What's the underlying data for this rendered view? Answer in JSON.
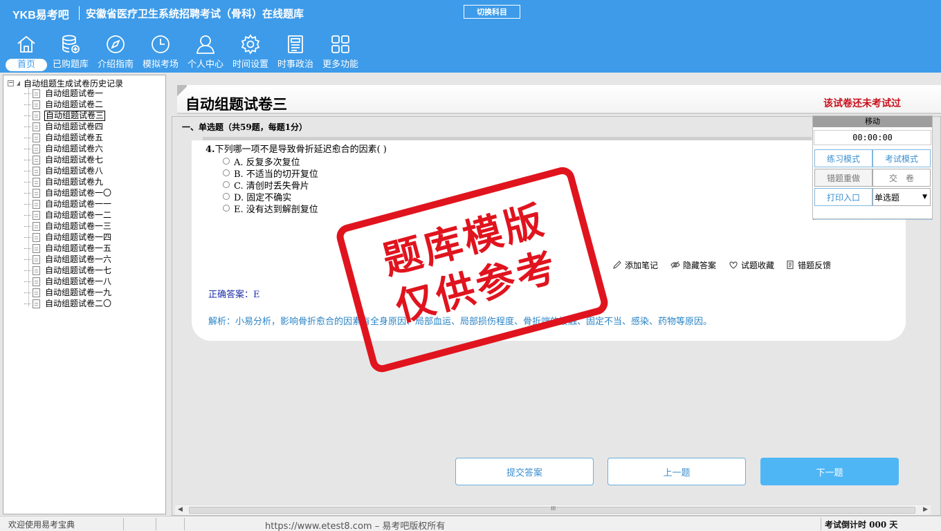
{
  "header": {
    "brand": "YKB易考吧",
    "exam_title": "安徽省医疗卫生系统招聘考试（骨科）在线题库",
    "switch_subject": "切换科目",
    "nav": [
      {
        "label": "首页",
        "icon": "home-icon"
      },
      {
        "label": "已购题库",
        "icon": "database-icon"
      },
      {
        "label": "介绍指南",
        "icon": "compass-icon"
      },
      {
        "label": "模拟考场",
        "icon": "clock-icon"
      },
      {
        "label": "个人中心",
        "icon": "user-icon"
      },
      {
        "label": "时间设置",
        "icon": "gear-icon"
      },
      {
        "label": "时事政治",
        "icon": "document-icon"
      },
      {
        "label": "更多功能",
        "icon": "grid-icon"
      }
    ]
  },
  "tree": {
    "root": "自动组题生成试卷历史记录",
    "items": [
      "自动组题试卷一",
      "自动组题试卷二",
      "自动组题试卷三",
      "自动组题试卷四",
      "自动组题试卷五",
      "自动组题试卷六",
      "自动组题试卷七",
      "自动组题试卷八",
      "自动组题试卷九",
      "自动组题试卷一〇",
      "自动组题试卷一一",
      "自动组题试卷一二",
      "自动组题试卷一三",
      "自动组题试卷一四",
      "自动组题试卷一五",
      "自动组题试卷一六",
      "自动组题试卷一七",
      "自动组题试卷一八",
      "自动组题试卷一九",
      "自动组题试卷二〇"
    ],
    "selected": "自动组题试卷三"
  },
  "paper": {
    "title": "自动组题试卷三",
    "status": "该试卷还未考试过",
    "section": "一、单选题（共59题，每题1分）"
  },
  "question": {
    "number": "4.",
    "text": "下列哪一项不是导致骨折延迟愈合的因素( )",
    "options": [
      "A. 反复多次复位",
      "B. 不适当的切开复位",
      "C. 清创时丢失骨片",
      "D. 固定不确实",
      "E. 没有达到解剖复位"
    ],
    "tools": [
      "添加笔记",
      "隐藏答案",
      "试题收藏",
      "错题反馈"
    ],
    "answer": "正确答案：E",
    "analysis": "解析：小易分析，影响骨折愈合的因素有全身原因、局部血运、局部损伤程度、骨折端的接触、固定不当、感染、药物等原因。"
  },
  "buttons": {
    "submit": "提交答案",
    "prev": "上一题",
    "next": "下一题"
  },
  "panel": {
    "move": "移动",
    "timer": "00:00:00",
    "practice": "练习模式",
    "exam": "考试模式",
    "redo": "错题重做",
    "hand_in": "交　卷",
    "print": "打印入口",
    "type_select": "单选题"
  },
  "stamp": {
    "line1": "题库模版",
    "line2": "仅供参考"
  },
  "status": {
    "welcome": "欢迎使用易考宝典",
    "url": "https://www.etest8.com – 易考吧版权所有",
    "countdown": "考试倒计时 000 天"
  }
}
